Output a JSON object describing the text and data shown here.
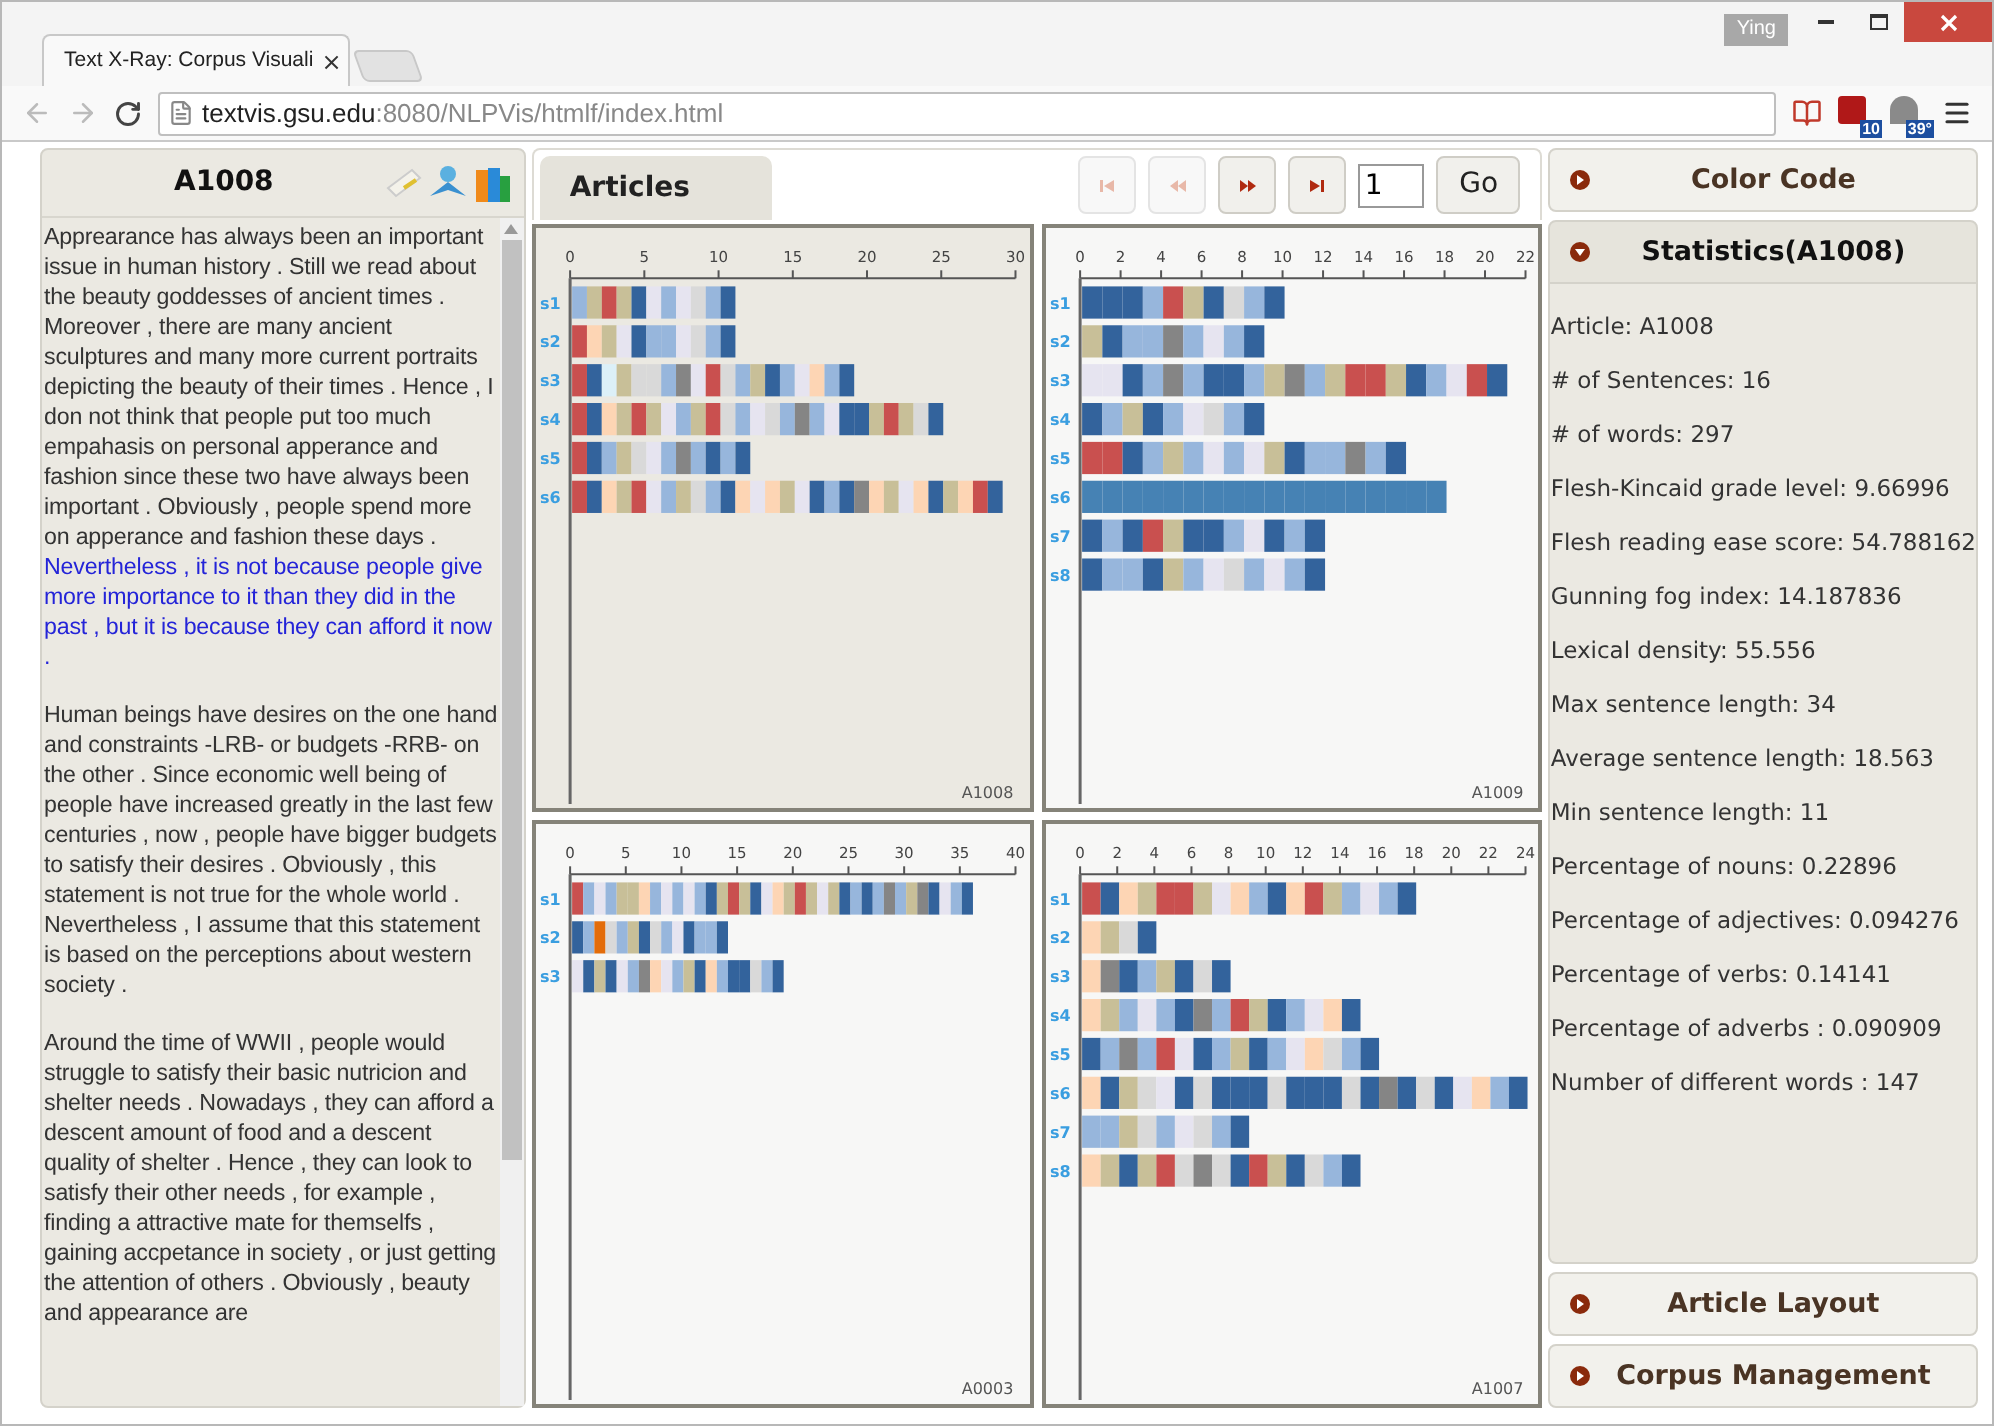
{
  "browser": {
    "tab_title": "Text X-Ray: Corpus Visuali",
    "tab_close": "×",
    "user": "Ying",
    "url_host": "textvis.gsu.edu",
    "url_path": ":8080/NLPVis/htmlf/index.html",
    "extension_badges": [
      "10",
      "39°"
    ]
  },
  "document_panel": {
    "title": "A1008",
    "paragraphs": [
      {
        "segments": [
          {
            "text": "Apprearance has always been an important issue in human history . Still we read about the beauty goddesses of ancient times . Moreover , there are many ancient sculptures and many more current portraits depicting the beauty of their times . Hence , I don not think that people put too much empahasis on personal apperance and fashion since these two have always been important . Obviously , people spend more on apperance and fashion these days . ",
            "highlighted": false
          },
          {
            "text": "Nevertheless , it is not because people give more importance to it than they did in the past , but it is because they can afford it now .",
            "highlighted": true
          }
        ]
      },
      {
        "segments": [
          {
            "text": "Human beings have desires on the one hand and constraints -LRB- or budgets -RRB- on the other . Since economic well being of people have increased greatly in the last few centuries , now , people have bigger budgets to satisfy their desires . Obviously , this statement is not true for the whole world . Nevertheless , I assume that this statement is based on the perceptions about western society .",
            "highlighted": false
          }
        ]
      },
      {
        "segments": [
          {
            "text": "Around the time of WWII , people would struggle to satisfy their basic nutricion and shelter needs . Nowadays , they can afford a descent amount of food and a descent quality of shelter . Hence , they can look to satisfy their other needs , for example , finding a attractive mate for themselfs , gaining accpetance in society , or just getting the attention of others . Obviously , beauty and appearance are",
            "highlighted": false
          }
        ]
      }
    ]
  },
  "center": {
    "tab": {
      "label": "Articles",
      "selected": true
    },
    "nav_buttons": [
      {
        "kind": "first",
        "disabled": true
      },
      {
        "kind": "prev",
        "disabled": true
      },
      {
        "kind": "next",
        "disabled": false
      },
      {
        "kind": "last",
        "disabled": false
      }
    ],
    "page_value": "1",
    "go_button": "Go",
    "panels": [
      {
        "article": "A1008",
        "selected": true,
        "ticks": [
          "0",
          "5",
          "10",
          "15",
          "20",
          "25",
          "30"
        ],
        "rows": [
          {
            "label": "s1",
            "cells": [
              {
                "color": "#97b6dc"
              },
              {
                "color": "#c8bf98"
              },
              {
                "color": "#c9504f"
              },
              {
                "color": "#c8bf98"
              },
              {
                "color": "#33639c"
              },
              {
                "color": "#e6e4f0"
              },
              {
                "color": "#97b6dc"
              },
              {
                "color": "#e6e4f0"
              },
              {
                "color": "#d9d9d9"
              },
              {
                "color": "#97b6dc"
              },
              {
                "color": "#33639c"
              }
            ]
          },
          {
            "label": "s2",
            "cells": [
              {
                "color": "#c9504f"
              },
              {
                "color": "#fdd5b4"
              },
              {
                "color": "#c8bf98"
              },
              {
                "color": "#e6e4f0"
              },
              {
                "color": "#33639c"
              },
              {
                "color": "#97b6dc"
              },
              {
                "color": "#97b6dc"
              },
              {
                "color": "#e6e4f0"
              },
              {
                "color": "#d9d9d9"
              },
              {
                "color": "#97b6dc"
              },
              {
                "color": "#33639c"
              }
            ]
          },
          {
            "label": "s3",
            "cells": [
              {
                "color": "#c9504f"
              },
              {
                "color": "#33639c"
              },
              {
                "color": "#dcf0f8"
              },
              {
                "color": "#c8bf98"
              },
              {
                "color": "#d9d9d9"
              },
              {
                "color": "#d9d9d9"
              },
              {
                "color": "#97b6dc"
              },
              {
                "color": "#858585"
              },
              {
                "color": "#e6e4f0"
              },
              {
                "color": "#c9504f"
              },
              {
                "color": "#d9d9d9"
              },
              {
                "color": "#97b6dc"
              },
              {
                "color": "#c8bf98"
              },
              {
                "color": "#33639c"
              },
              {
                "color": "#97b6dc"
              },
              {
                "color": "#e6e4f0"
              },
              {
                "color": "#fdd5b4"
              },
              {
                "color": "#97b6dc"
              },
              {
                "color": "#33639c"
              }
            ]
          },
          {
            "label": "s4",
            "cells": [
              {
                "color": "#c9504f"
              },
              {
                "color": "#33639c"
              },
              {
                "color": "#fdd5b4"
              },
              {
                "color": "#c8bf98"
              },
              {
                "color": "#c9504f"
              },
              {
                "color": "#c8bf98"
              },
              {
                "color": "#e6e4f0"
              },
              {
                "color": "#97b6dc"
              },
              {
                "color": "#c8bf98"
              },
              {
                "color": "#c9504f"
              },
              {
                "color": "#d9d9d9"
              },
              {
                "color": "#97b6dc"
              },
              {
                "color": "#e6e4f0"
              },
              {
                "color": "#d9d9d9"
              },
              {
                "color": "#97b6dc"
              },
              {
                "color": "#858585"
              },
              {
                "color": "#97b6dc"
              },
              {
                "color": "#e6e4f0"
              },
              {
                "color": "#33639c"
              },
              {
                "color": "#33639c"
              },
              {
                "color": "#c8bf98"
              },
              {
                "color": "#c9504f"
              },
              {
                "color": "#c8bf98"
              },
              {
                "color": "#d9d9d9"
              },
              {
                "color": "#33639c"
              }
            ]
          },
          {
            "label": "s5",
            "cells": [
              {
                "color": "#c9504f"
              },
              {
                "color": "#33639c"
              },
              {
                "color": "#97b6dc"
              },
              {
                "color": "#c8bf98"
              },
              {
                "color": "#d9d9d9"
              },
              {
                "color": "#e6e4f0"
              },
              {
                "color": "#97b6dc"
              },
              {
                "color": "#858585"
              },
              {
                "color": "#97b6dc"
              },
              {
                "color": "#33639c"
              },
              {
                "color": "#97b6dc"
              },
              {
                "color": "#33639c"
              }
            ]
          },
          {
            "label": "s6",
            "cells": [
              {
                "color": "#c9504f"
              },
              {
                "color": "#33639c"
              },
              {
                "color": "#fdd5b4"
              },
              {
                "color": "#c8bf98"
              },
              {
                "color": "#c9504f"
              },
              {
                "color": "#e6e4f0"
              },
              {
                "color": "#97b6dc"
              },
              {
                "color": "#c8bf98"
              },
              {
                "color": "#d9d9d9"
              },
              {
                "color": "#97b6dc"
              },
              {
                "color": "#33639c"
              },
              {
                "color": "#fdd5b4"
              },
              {
                "color": "#e6e4f0"
              },
              {
                "color": "#fdd5b4"
              },
              {
                "color": "#c8bf98"
              },
              {
                "color": "#e6e4f0"
              },
              {
                "color": "#33639c"
              },
              {
                "color": "#97b6dc"
              },
              {
                "color": "#33639c"
              },
              {
                "color": "#858585"
              },
              {
                "color": "#fdd5b4"
              },
              {
                "color": "#c8bf98"
              },
              {
                "color": "#e6e4f0"
              },
              {
                "color": "#fdd5b4"
              },
              {
                "color": "#33639c"
              },
              {
                "color": "#c8bf98"
              },
              {
                "color": "#fdd5b4"
              },
              {
                "color": "#c9504f"
              },
              {
                "color": "#33639c"
              }
            ]
          }
        ]
      },
      {
        "article": "A1009",
        "selected": false,
        "ticks": [
          "0",
          "2",
          "4",
          "6",
          "8",
          "10",
          "12",
          "14",
          "16",
          "18",
          "20",
          "22"
        ],
        "rows": [
          {
            "label": "s1",
            "cells": [
              {
                "color": "#33639c"
              },
              {
                "color": "#33639c"
              },
              {
                "color": "#33639c"
              },
              {
                "color": "#97b6dc"
              },
              {
                "color": "#c9504f"
              },
              {
                "color": "#c8bf98"
              },
              {
                "color": "#33639c"
              },
              {
                "color": "#d9d9d9"
              },
              {
                "color": "#97b6dc"
              },
              {
                "color": "#33639c"
              }
            ]
          },
          {
            "label": "s2",
            "cells": [
              {
                "color": "#c8bf98"
              },
              {
                "color": "#33639c"
              },
              {
                "color": "#97b6dc"
              },
              {
                "color": "#97b6dc"
              },
              {
                "color": "#858585"
              },
              {
                "color": "#97b6dc"
              },
              {
                "color": "#e6e4f0"
              },
              {
                "color": "#97b6dc"
              },
              {
                "color": "#33639c"
              }
            ]
          },
          {
            "label": "s3",
            "cells": [
              {
                "color": "#e6e4f0"
              },
              {
                "color": "#e6e4f0"
              },
              {
                "color": "#33639c"
              },
              {
                "color": "#97b6dc"
              },
              {
                "color": "#858585"
              },
              {
                "color": "#97b6dc"
              },
              {
                "color": "#33639c"
              },
              {
                "color": "#33639c"
              },
              {
                "color": "#97b6dc"
              },
              {
                "color": "#c8bf98"
              },
              {
                "color": "#858585"
              },
              {
                "color": "#97b6dc"
              },
              {
                "color": "#c8bf98"
              },
              {
                "color": "#c9504f"
              },
              {
                "color": "#c9504f"
              },
              {
                "color": "#c8bf98"
              },
              {
                "color": "#33639c"
              },
              {
                "color": "#97b6dc"
              },
              {
                "color": "#e6e4f0"
              },
              {
                "color": "#c9504f"
              },
              {
                "color": "#33639c"
              }
            ]
          },
          {
            "label": "s4",
            "cells": [
              {
                "color": "#33639c"
              },
              {
                "color": "#97b6dc"
              },
              {
                "color": "#c8bf98"
              },
              {
                "color": "#33639c"
              },
              {
                "color": "#97b6dc"
              },
              {
                "color": "#e6e4f0"
              },
              {
                "color": "#d9d9d9"
              },
              {
                "color": "#97b6dc"
              },
              {
                "color": "#33639c"
              }
            ]
          },
          {
            "label": "s5",
            "cells": [
              {
                "color": "#c9504f"
              },
              {
                "color": "#c9504f"
              },
              {
                "color": "#33639c"
              },
              {
                "color": "#97b6dc"
              },
              {
                "color": "#c8bf98"
              },
              {
                "color": "#97b6dc"
              },
              {
                "color": "#e6e4f0"
              },
              {
                "color": "#97b6dc"
              },
              {
                "color": "#e6e4f0"
              },
              {
                "color": "#c8bf98"
              },
              {
                "color": "#33639c"
              },
              {
                "color": "#97b6dc"
              },
              {
                "color": "#97b6dc"
              },
              {
                "color": "#858585"
              },
              {
                "color": "#97b6dc"
              },
              {
                "color": "#33639c"
              }
            ]
          },
          {
            "label": "s6",
            "cells": [
              {
                "color": "#4682b4"
              },
              {
                "color": "#4682b4"
              },
              {
                "color": "#4682b4"
              },
              {
                "color": "#4682b4"
              },
              {
                "color": "#4682b4"
              },
              {
                "color": "#4682b4"
              },
              {
                "color": "#4682b4"
              },
              {
                "color": "#4682b4"
              },
              {
                "color": "#4682b4"
              },
              {
                "color": "#4682b4"
              },
              {
                "color": "#4682b4"
              },
              {
                "color": "#4682b4"
              },
              {
                "color": "#4682b4"
              },
              {
                "color": "#4682b4"
              },
              {
                "color": "#4682b4"
              },
              {
                "color": "#4682b4"
              },
              {
                "color": "#4682b4"
              },
              {
                "color": "#4682b4"
              }
            ]
          },
          {
            "label": "s7",
            "cells": [
              {
                "color": "#33639c"
              },
              {
                "color": "#97b6dc"
              },
              {
                "color": "#33639c"
              },
              {
                "color": "#c9504f"
              },
              {
                "color": "#c8bf98"
              },
              {
                "color": "#33639c"
              },
              {
                "color": "#33639c"
              },
              {
                "color": "#97b6dc"
              },
              {
                "color": "#e6e4f0"
              },
              {
                "color": "#33639c"
              },
              {
                "color": "#97b6dc"
              },
              {
                "color": "#33639c"
              }
            ]
          },
          {
            "label": "s8",
            "cells": [
              {
                "color": "#33639c"
              },
              {
                "color": "#97b6dc"
              },
              {
                "color": "#97b6dc"
              },
              {
                "color": "#33639c"
              },
              {
                "color": "#c8bf98"
              },
              {
                "color": "#97b6dc"
              },
              {
                "color": "#e6e4f0"
              },
              {
                "color": "#d9d9d9"
              },
              {
                "color": "#97b6dc"
              },
              {
                "color": "#e6e4f0"
              },
              {
                "color": "#97b6dc"
              },
              {
                "color": "#33639c"
              }
            ]
          }
        ]
      },
      {
        "article": "A0003",
        "selected": false,
        "ticks": [
          "0",
          "5",
          "10",
          "15",
          "20",
          "25",
          "30",
          "35",
          "40"
        ],
        "rows": [
          {
            "label": "s1",
            "cells": [
              {
                "color": "#c9504f"
              },
              {
                "color": "#97b6dc"
              },
              {
                "color": "#e6e4f0"
              },
              {
                "color": "#97b6dc"
              },
              {
                "color": "#c8bf98"
              },
              {
                "color": "#c8bf98"
              },
              {
                "color": "#fdd5b4"
              },
              {
                "color": "#97b6dc"
              },
              {
                "color": "#e6e4f0"
              },
              {
                "color": "#97b6dc"
              },
              {
                "color": "#e6e4f0"
              },
              {
                "color": "#97b6dc"
              },
              {
                "color": "#33639c"
              },
              {
                "color": "#c8bf98"
              },
              {
                "color": "#c9504f"
              },
              {
                "color": "#c8bf98"
              },
              {
                "color": "#33639c"
              },
              {
                "color": "#e6e4f0"
              },
              {
                "color": "#fdd5b4"
              },
              {
                "color": "#c8bf98"
              },
              {
                "color": "#c9504f"
              },
              {
                "color": "#c8bf98"
              },
              {
                "color": "#e6e4f0"
              },
              {
                "color": "#c8bf98"
              },
              {
                "color": "#33639c"
              },
              {
                "color": "#97b6dc"
              },
              {
                "color": "#33639c"
              },
              {
                "color": "#97b6dc"
              },
              {
                "color": "#858585"
              },
              {
                "color": "#97b6dc"
              },
              {
                "color": "#c8bf98"
              },
              {
                "color": "#858585"
              },
              {
                "color": "#33639c"
              },
              {
                "color": "#e6e4f0"
              },
              {
                "color": "#97b6dc"
              },
              {
                "color": "#33639c"
              }
            ]
          },
          {
            "label": "s2",
            "cells": [
              {
                "color": "#33639c"
              },
              {
                "color": "#97b6dc"
              },
              {
                "color": "#e36c0a"
              },
              {
                "color": "#d9d9d9"
              },
              {
                "color": "#97b6dc"
              },
              {
                "color": "#c8bf98"
              },
              {
                "color": "#33639c"
              },
              {
                "color": "#d9d9d9"
              },
              {
                "color": "#97b6dc"
              },
              {
                "color": "#e6e4f0"
              },
              {
                "color": "#33639c"
              },
              {
                "color": "#97b6dc"
              },
              {
                "color": "#97b6dc"
              },
              {
                "color": "#33639c"
              }
            ]
          },
          {
            "label": "s3",
            "cells": [
              {
                "color": "#e6e4f0"
              },
              {
                "color": "#33639c"
              },
              {
                "color": "#c8bf98"
              },
              {
                "color": "#33639c"
              },
              {
                "color": "#e6e4f0"
              },
              {
                "color": "#97b6dc"
              },
              {
                "color": "#858585"
              },
              {
                "color": "#fdd5b4"
              },
              {
                "color": "#e6e4f0"
              },
              {
                "color": "#97b6dc"
              },
              {
                "color": "#c8bf98"
              },
              {
                "color": "#33639c"
              },
              {
                "color": "#fdd5b4"
              },
              {
                "color": "#97b6dc"
              },
              {
                "color": "#33639c"
              },
              {
                "color": "#33639c"
              },
              {
                "color": "#d9d9d9"
              },
              {
                "color": "#97b6dc"
              },
              {
                "color": "#33639c"
              }
            ]
          }
        ]
      },
      {
        "article": "A1007",
        "selected": false,
        "ticks": [
          "0",
          "2",
          "4",
          "6",
          "8",
          "10",
          "12",
          "14",
          "16",
          "18",
          "20",
          "22",
          "24"
        ],
        "rows": [
          {
            "label": "s1",
            "cells": [
              {
                "color": "#c9504f"
              },
              {
                "color": "#33639c"
              },
              {
                "color": "#fdd5b4"
              },
              {
                "color": "#c8bf98"
              },
              {
                "color": "#c9504f"
              },
              {
                "color": "#c9504f"
              },
              {
                "color": "#c8bf98"
              },
              {
                "color": "#e6e4f0"
              },
              {
                "color": "#fdd5b4"
              },
              {
                "color": "#97b6dc"
              },
              {
                "color": "#33639c"
              },
              {
                "color": "#fdd5b4"
              },
              {
                "color": "#c9504f"
              },
              {
                "color": "#c8bf98"
              },
              {
                "color": "#97b6dc"
              },
              {
                "color": "#e6e4f0"
              },
              {
                "color": "#97b6dc"
              },
              {
                "color": "#33639c"
              }
            ]
          },
          {
            "label": "s2",
            "cells": [
              {
                "color": "#fdd5b4"
              },
              {
                "color": "#c8bf98"
              },
              {
                "color": "#d9d9d9"
              },
              {
                "color": "#33639c"
              }
            ]
          },
          {
            "label": "s3",
            "cells": [
              {
                "color": "#fdd5b4"
              },
              {
                "color": "#858585"
              },
              {
                "color": "#33639c"
              },
              {
                "color": "#97b6dc"
              },
              {
                "color": "#c8bf98"
              },
              {
                "color": "#33639c"
              },
              {
                "color": "#d9d9d9"
              },
              {
                "color": "#33639c"
              }
            ]
          },
          {
            "label": "s4",
            "cells": [
              {
                "color": "#fdd5b4"
              },
              {
                "color": "#c8bf98"
              },
              {
                "color": "#97b6dc"
              },
              {
                "color": "#e6e4f0"
              },
              {
                "color": "#97b6dc"
              },
              {
                "color": "#33639c"
              },
              {
                "color": "#858585"
              },
              {
                "color": "#97b6dc"
              },
              {
                "color": "#c9504f"
              },
              {
                "color": "#c8bf98"
              },
              {
                "color": "#33639c"
              },
              {
                "color": "#97b6dc"
              },
              {
                "color": "#e6e4f0"
              },
              {
                "color": "#fdd5b4"
              },
              {
                "color": "#33639c"
              }
            ]
          },
          {
            "label": "s5",
            "cells": [
              {
                "color": "#33639c"
              },
              {
                "color": "#97b6dc"
              },
              {
                "color": "#858585"
              },
              {
                "color": "#97b6dc"
              },
              {
                "color": "#c9504f"
              },
              {
                "color": "#e6e4f0"
              },
              {
                "color": "#33639c"
              },
              {
                "color": "#97b6dc"
              },
              {
                "color": "#c8bf98"
              },
              {
                "color": "#33639c"
              },
              {
                "color": "#97b6dc"
              },
              {
                "color": "#e6e4f0"
              },
              {
                "color": "#fdd5b4"
              },
              {
                "color": "#d9d9d9"
              },
              {
                "color": "#97b6dc"
              },
              {
                "color": "#33639c"
              }
            ]
          },
          {
            "label": "s6",
            "cells": [
              {
                "color": "#fdd5b4"
              },
              {
                "color": "#33639c"
              },
              {
                "color": "#c8bf98"
              },
              {
                "color": "#d9d9d9"
              },
              {
                "color": "#e6e4f0"
              },
              {
                "color": "#33639c"
              },
              {
                "color": "#d9d9d9"
              },
              {
                "color": "#33639c"
              },
              {
                "color": "#33639c"
              },
              {
                "color": "#33639c"
              },
              {
                "color": "#d9d9d9"
              },
              {
                "color": "#33639c"
              },
              {
                "color": "#33639c"
              },
              {
                "color": "#33639c"
              },
              {
                "color": "#d9d9d9"
              },
              {
                "color": "#33639c"
              },
              {
                "color": "#858585"
              },
              {
                "color": "#33639c"
              },
              {
                "color": "#d9d9d9"
              },
              {
                "color": "#33639c"
              },
              {
                "color": "#e6e4f0"
              },
              {
                "color": "#fdd5b4"
              },
              {
                "color": "#97b6dc"
              },
              {
                "color": "#33639c"
              }
            ]
          },
          {
            "label": "s7",
            "cells": [
              {
                "color": "#97b6dc"
              },
              {
                "color": "#97b6dc"
              },
              {
                "color": "#c8bf98"
              },
              {
                "color": "#d9d9d9"
              },
              {
                "color": "#97b6dc"
              },
              {
                "color": "#e6e4f0"
              },
              {
                "color": "#d9d9d9"
              },
              {
                "color": "#97b6dc"
              },
              {
                "color": "#33639c"
              }
            ]
          },
          {
            "label": "s8",
            "cells": [
              {
                "color": "#fdd5b4"
              },
              {
                "color": "#c8bf98"
              },
              {
                "color": "#33639c"
              },
              {
                "color": "#c8bf98"
              },
              {
                "color": "#c9504f"
              },
              {
                "color": "#d9d9d9"
              },
              {
                "color": "#858585"
              },
              {
                "color": "#d9d9d9"
              },
              {
                "color": "#33639c"
              },
              {
                "color": "#c9504f"
              },
              {
                "color": "#c8bf98"
              },
              {
                "color": "#33639c"
              },
              {
                "color": "#d9d9d9"
              },
              {
                "color": "#97b6dc"
              },
              {
                "color": "#33639c"
              }
            ]
          }
        ]
      }
    ]
  },
  "sidebar": {
    "sections": [
      {
        "title": "Color Code",
        "expanded": false
      },
      {
        "title": "Statistics(A1008)",
        "expanded": true,
        "items": [
          "Article: A1008",
          "# of Sentences: 16",
          "# of words: 297",
          "Flesh-Kincaid grade level: 9.66996",
          "Flesh reading ease score: 54.788162",
          "Gunning fog index: 14.187836",
          "Lexical density: 55.556",
          "Max sentence length: 34",
          "Average sentence length: 18.563",
          "Min sentence length: 11",
          "Percentage of nouns: 0.22896",
          "Percentage of adjectives: 0.094276",
          "Percentage of verbs: 0.14141",
          "Percentage of adverbs : 0.090909",
          "Number of different words : 147"
        ]
      },
      {
        "title": "Article Layout",
        "expanded": false
      },
      {
        "title": "Corpus Management",
        "expanded": false
      }
    ]
  }
}
